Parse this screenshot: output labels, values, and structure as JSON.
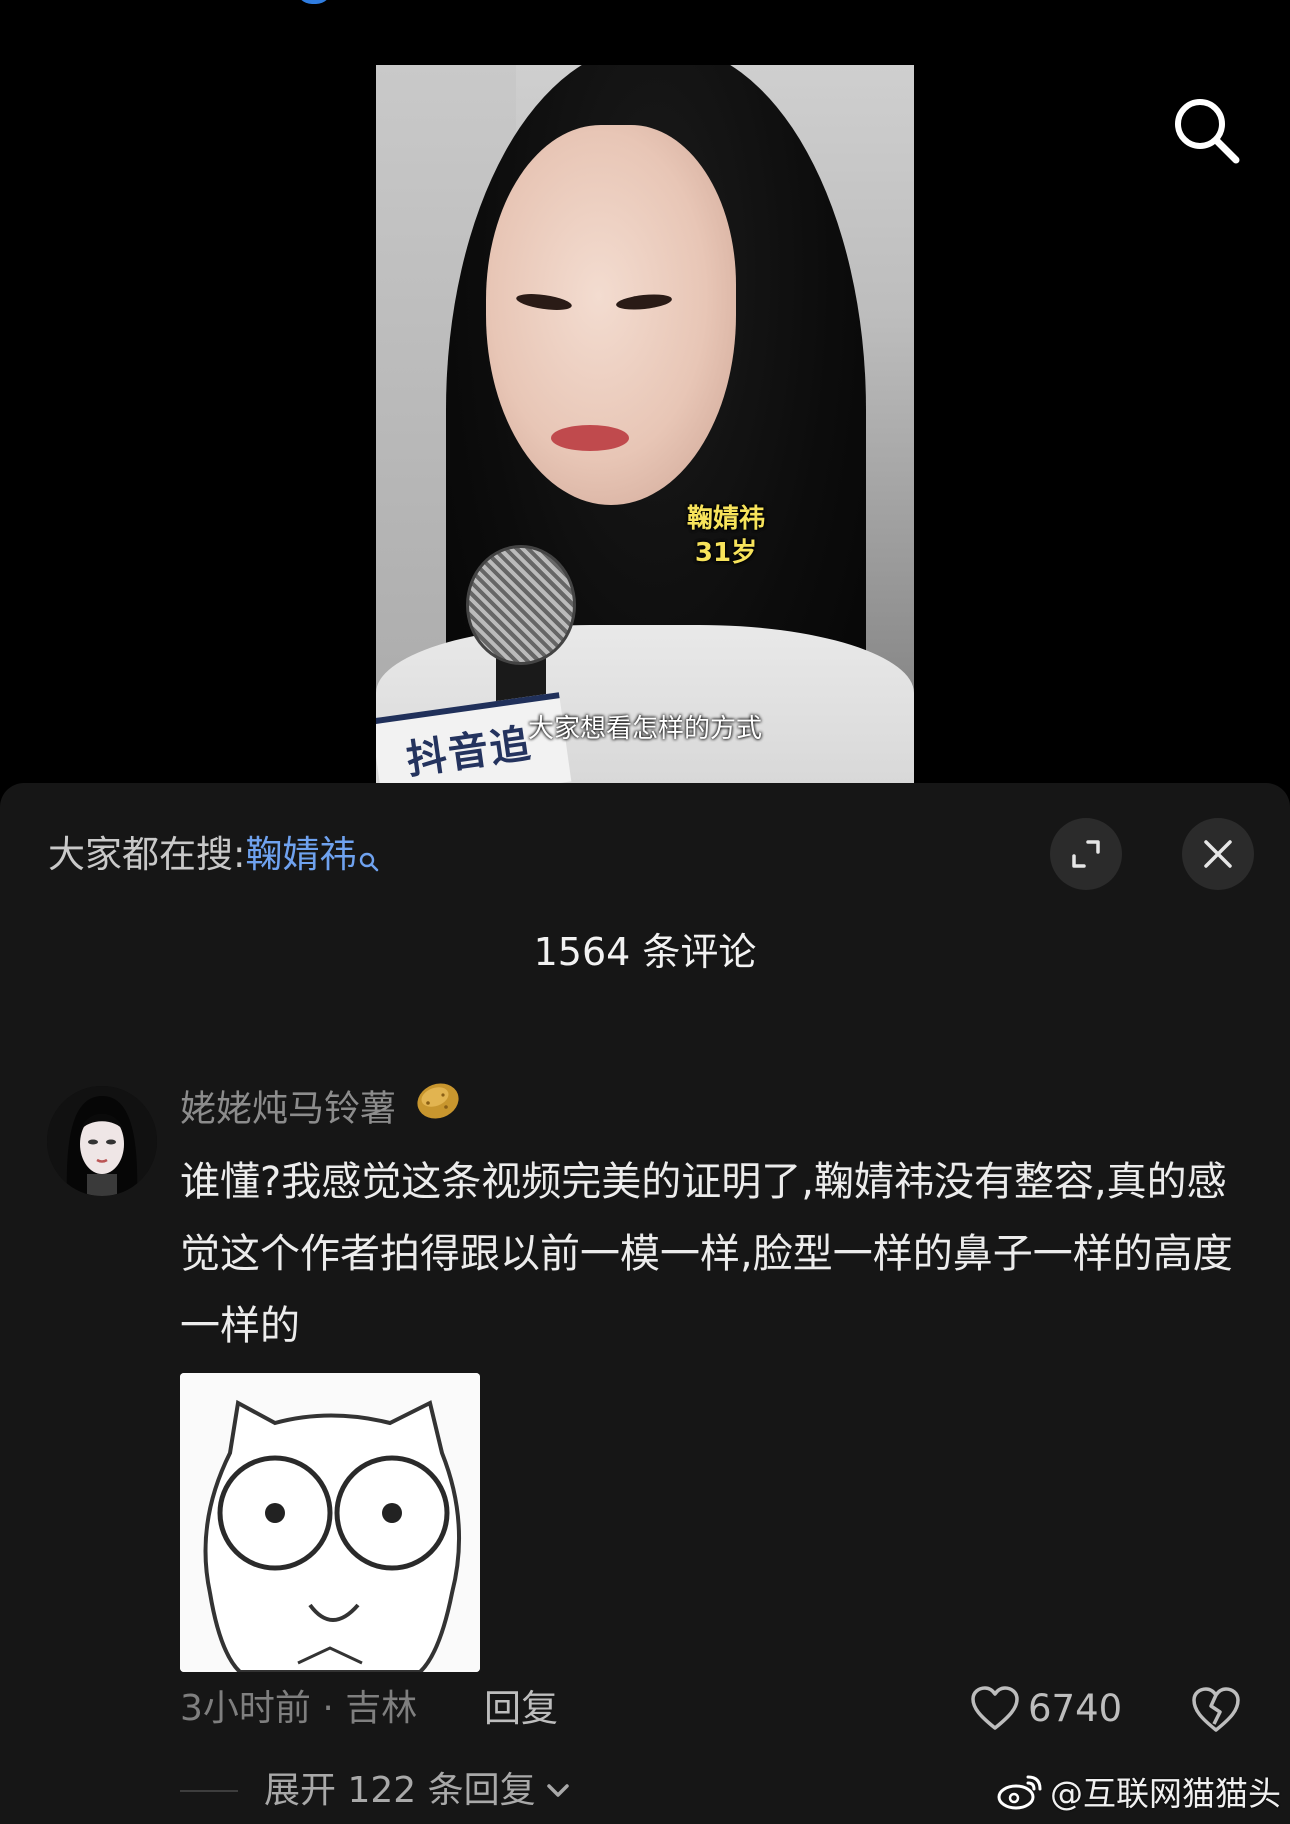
{
  "video": {
    "overlay_name": "鞠婧祎",
    "overlay_age": "31岁",
    "subtitle": "大家想看怎样的方式",
    "mic_flag_text": "抖音追剧团"
  },
  "header_icons": {
    "search": "search-icon"
  },
  "comments_panel": {
    "trending_prefix": "大家都在搜:",
    "trending_keyword": "鞠婧祎",
    "expand_icon": "expand-icon",
    "close_icon": "close-icon",
    "count_title": "1564 条评论"
  },
  "comment": {
    "username": "姥姥炖马铃薯",
    "text": "谁懂?我感觉这条视频完美的证明了,鞠婧祎没有整容,真的感觉这个作者拍得跟以前一模一样,脸型一样的鼻子一样的高度一样的",
    "time_location": "3小时前 · 吉林",
    "reply_label": "回复",
    "likes": "6740",
    "expand_replies": "展开 122 条回复"
  },
  "watermark": {
    "text": "@互联网猫猫头"
  },
  "colors": {
    "background": "#000000",
    "sheet": "#161616",
    "keyword": "#6fa2ef",
    "name_tag": "#f7e35b"
  }
}
